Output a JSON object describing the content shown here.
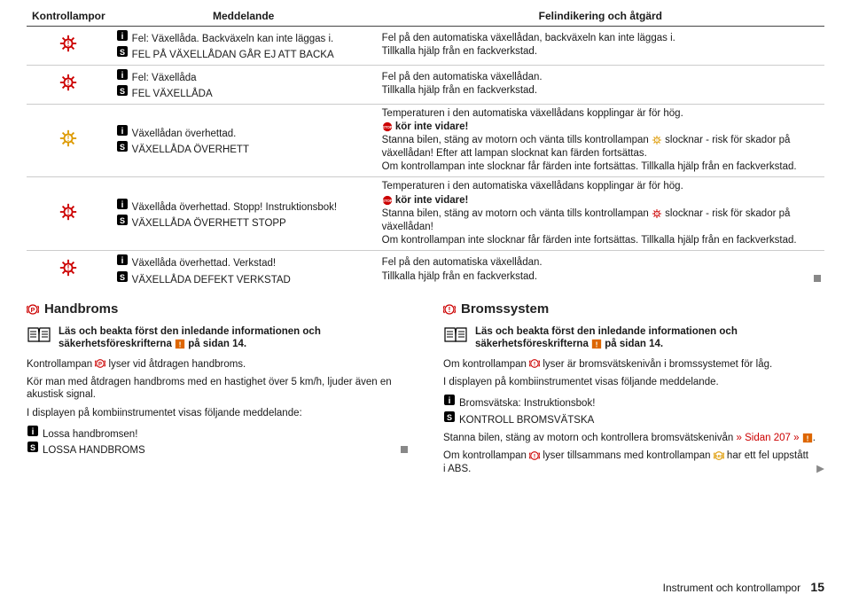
{
  "table": {
    "headers": [
      "Kontrollampor",
      "Meddelande",
      "Felindikering och åtgärd"
    ],
    "rows": [
      {
        "lamp_color": "red",
        "msg_i": "Fel: Växellåda. Backväxeln kan inte läggas i.",
        "msg_s": "FEL PÅ VÄXELLÅDAN GÅR EJ ATT BACKA",
        "action_lines": [
          "Fel på den automatiska växellådan, backväxeln kan inte läggas i.",
          "Tillkalla hjälp från en fackverkstad."
        ]
      },
      {
        "lamp_color": "red",
        "msg_i": "Fel: Växellåda",
        "msg_s": "FEL VÄXELLÅDA",
        "action_lines": [
          "Fel på den automatiska växellådan.",
          "Tillkalla hjälp från en fackverkstad."
        ]
      },
      {
        "lamp_color": "yellow",
        "msg_i": "Växellådan överhettad.",
        "msg_s": "VÄXELLÅDA ÖVERHETT",
        "action_complex": {
          "pre": "Temperaturen i den automatiska växellådans kopplingar är för hög.",
          "stop": " kör inte vidare!",
          "mid_a": "Stanna bilen, stäng av motorn och vänta tills kontrollampan ",
          "mid_b": " slocknar - risk för skador på växellådan! Efter att lampan slocknat kan färden fortsättas.",
          "post": "Om kontrollampan inte slocknar får färden inte fortsättas. Tillkalla hjälp från en fackverkstad."
        }
      },
      {
        "lamp_color": "red",
        "msg_i": "Växellåda överhettad. Stopp! Instruktionsbok!",
        "msg_s": "VÄXELLÅDA ÖVERHETT STOPP",
        "action_complex": {
          "pre": "Temperaturen i den automatiska växellådans kopplingar är för hög.",
          "stop": " kör inte vidare!",
          "mid_a": "Stanna bilen, stäng av motorn och vänta tills kontrollampan ",
          "mid_b": " slocknar - risk för skador på växellådan!",
          "post": "Om kontrollampan inte slocknar får färden inte fortsättas. Tillkalla hjälp från en fackverkstad."
        }
      },
      {
        "lamp_color": "red",
        "msg_i": "Växellåda överhettad. Verkstad!",
        "msg_s": "VÄXELLÅDA DEFEKT VERKSTAD",
        "action_lines": [
          "Fel på den automatiska växellådan.",
          "Tillkalla hjälp från en fackverkstad."
        ]
      }
    ]
  },
  "left": {
    "heading": "Handbroms",
    "notice_a": "Läs och beakta först den inledande informationen och säkerhetsföreskrifterna ",
    "notice_b": " på sidan 14.",
    "p1_a": "Kontrollampan ",
    "p1_b": " lyser vid åtdragen handbroms.",
    "p2": "Kör man med åtdragen handbroms med en hastighet över 5 km/h, ljuder även en akustisk signal.",
    "p3": "I displayen på kombiinstrumentet visas följande meddelande:",
    "msg_i": "Lossa handbromsen!",
    "msg_s": "LOSSA HANDBROMS"
  },
  "right": {
    "heading": "Bromssystem",
    "notice_a": "Läs och beakta först den inledande informationen och säkerhetsföreskrifterna ",
    "notice_b": " på sidan 14.",
    "p1_a": "Om kontrollampan ",
    "p1_b": " lyser är bromsvätskenivån i bromssystemet för låg.",
    "p2": "I displayen på kombiinstrumentet visas följande meddelande.",
    "msg_i": "Bromsvätska: Instruktionsbok!",
    "msg_s": "KONTROLL BROMSVÄTSKA",
    "p3_a": "Stanna bilen, stäng av motorn och kontrollera bromsvätskenivån ",
    "p3_link": "» Sidan 207 »",
    "p3_b": ".",
    "p4_a": "Om kontrollampan ",
    "p4_b": " lyser tillsammans med kontrollampan ",
    "p4_c": " har ett fel uppstått i ABS."
  },
  "footer": {
    "label": "Instrument och kontrollampor",
    "page": "15"
  }
}
